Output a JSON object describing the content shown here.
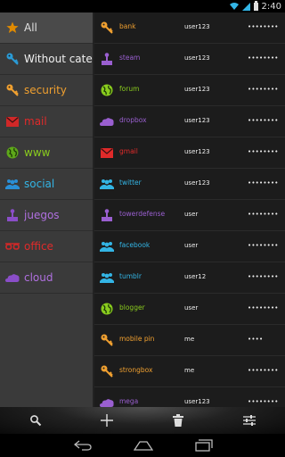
{
  "status_bar": {
    "time": "2:40"
  },
  "categories": [
    {
      "label": "All",
      "color": "#e0e0e0",
      "icon": "star-icon",
      "icon_color": "#e08a00",
      "selected": true
    },
    {
      "label": "Without categ…",
      "color": "#f0f0f0",
      "icon": "key-icon",
      "icon_color": "#2a9bd6"
    },
    {
      "label": "security",
      "color": "#f0a030",
      "icon": "key-icon",
      "icon_color": "#f0a030"
    },
    {
      "label": "mail",
      "color": "#e02a2a",
      "icon": "mail-icon",
      "icon_color": "#d02828"
    },
    {
      "label": "www",
      "color": "#8acc1e",
      "icon": "globe-icon",
      "icon_color": "#5ea81a"
    },
    {
      "label": "social",
      "color": "#33b5e5",
      "icon": "people-icon",
      "icon_color": "#2a8fd6"
    },
    {
      "label": "juegos",
      "color": "#b070e0",
      "icon": "joystick-icon",
      "icon_color": "#8a4ec8"
    },
    {
      "label": "office",
      "color": "#e02a2a",
      "icon": "glasses-icon",
      "icon_color": "#d02828"
    },
    {
      "label": "cloud",
      "color": "#b070e0",
      "icon": "cloud-icon",
      "icon_color": "#8a4ec8"
    }
  ],
  "entries": [
    {
      "name": "bank",
      "user": "user123",
      "password": "••••••••",
      "color": "#f0a030",
      "icon": "key-icon"
    },
    {
      "name": "steam",
      "user": "user123",
      "password": "••••••••",
      "color": "#9a5fd0",
      "icon": "joystick-icon"
    },
    {
      "name": "forum",
      "user": "user123",
      "password": "••••••••",
      "color": "#8acc1e",
      "icon": "globe-icon"
    },
    {
      "name": "dropbox",
      "user": "user123",
      "password": "••••••••",
      "color": "#9a5fd0",
      "icon": "cloud-icon"
    },
    {
      "name": "gmail",
      "user": "user123",
      "password": "••••••••",
      "color": "#e02a2a",
      "icon": "mail-icon"
    },
    {
      "name": "twitter",
      "user": "user123",
      "password": "••••••••",
      "color": "#33b5e5",
      "icon": "people-icon"
    },
    {
      "name": "towerdefense",
      "user": "user",
      "password": "••••••••",
      "color": "#9a5fd0",
      "icon": "joystick-icon"
    },
    {
      "name": "facebook",
      "user": "user",
      "password": "••••••••",
      "color": "#33b5e5",
      "icon": "people-icon"
    },
    {
      "name": "tumblr",
      "user": "user12",
      "password": "••••••••",
      "color": "#33b5e5",
      "icon": "people-icon"
    },
    {
      "name": "blogger",
      "user": "user",
      "password": "••••••••",
      "color": "#8acc1e",
      "icon": "globe-icon"
    },
    {
      "name": "mobile pin",
      "user": "me",
      "password": "••••",
      "color": "#f0a030",
      "icon": "key-icon"
    },
    {
      "name": "strongbox",
      "user": "me",
      "password": "••••••••",
      "color": "#f0a030",
      "icon": "key-icon"
    },
    {
      "name": "mega",
      "user": "user123",
      "password": "••••••••",
      "color": "#9a5fd0",
      "icon": "cloud-icon"
    }
  ],
  "action_bar": [
    "search-icon",
    "add-icon",
    "trash-icon",
    "settings-sliders-icon"
  ],
  "nav_bar": [
    "back-icon",
    "home-icon",
    "recents-icon"
  ]
}
